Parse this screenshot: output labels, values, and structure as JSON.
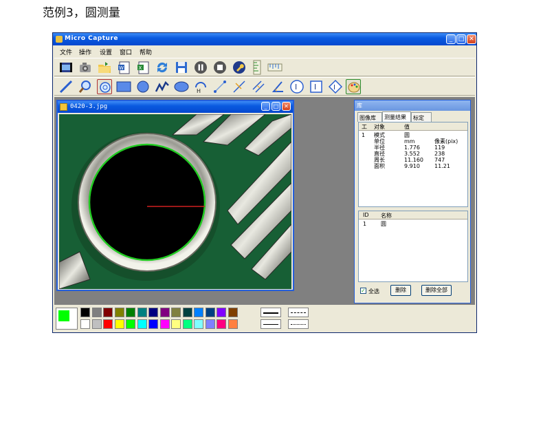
{
  "heading": "范例3，圆测量",
  "window": {
    "title": "Micro Capture"
  },
  "menu": [
    "文件",
    "操作",
    "设置",
    "窗口",
    "帮助"
  ],
  "image_window": {
    "title": "0420-3.jpg"
  },
  "panel": {
    "title": "库",
    "tabs": [
      "图像库",
      "测量结果",
      "标定"
    ],
    "results_headers": [
      "工",
      "对象",
      "值"
    ],
    "results_rows": [
      [
        "1",
        "模式",
        "圆",
        ""
      ],
      [
        "",
        "单位",
        "mm",
        "像素(pix)"
      ],
      [
        "",
        "半径",
        "1.776",
        "119"
      ],
      [
        "",
        "直径",
        "3.552",
        "238"
      ],
      [
        "",
        "周长",
        "11.160",
        "747"
      ],
      [
        "",
        "面积",
        "9.910",
        "11.21"
      ]
    ],
    "objects_headers": [
      "ID",
      "名称"
    ],
    "objects_rows": [
      [
        "1",
        "圆"
      ]
    ],
    "select_all_label": "全选",
    "delete_label": "删除",
    "delete_all_label": "删除全部"
  },
  "palette": {
    "row1": [
      "#000000",
      "#808080",
      "#800000",
      "#808000",
      "#008000",
      "#008080",
      "#000080",
      "#800080",
      "#808040",
      "#004040",
      "#0080ff",
      "#004080",
      "#8000ff",
      "#804000"
    ],
    "row2": [
      "#ffffff",
      "#c0c0c0",
      "#ff0000",
      "#ffff00",
      "#00ff00",
      "#00ffff",
      "#0000ff",
      "#ff00ff",
      "#ffff80",
      "#00ff80",
      "#80ffff",
      "#8080ff",
      "#ff0080",
      "#ff8040"
    ],
    "foreground": "#00ff00",
    "background": "#ff0000"
  }
}
